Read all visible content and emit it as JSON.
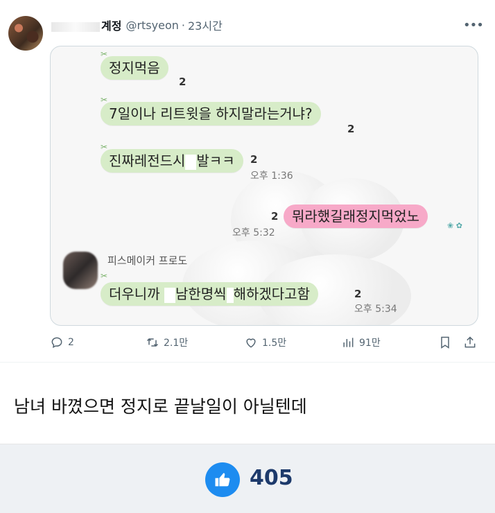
{
  "tweet": {
    "name_visible": "계정",
    "handle": "@rtsyeon",
    "dot": "·",
    "time": "23시간",
    "more_icon": "more-horizontal-icon"
  },
  "chat": {
    "messages": [
      {
        "text": "정지먹음",
        "count": "2"
      },
      {
        "text": "7일이나 리트윗을 하지말라는거냐?",
        "count": "2"
      },
      {
        "text_before": "진짜레전드시",
        "text_after": "발ㅋㅋ",
        "count": "2",
        "time": "오후 1:36"
      },
      {
        "text": "뭐라했길래정지먹었노",
        "count": "2",
        "time": "오후 5:32",
        "color": "#f7a9c8"
      },
      {
        "sender": "피스메이커 프로도",
        "text_before": "더우니까 ",
        "text_middle": "남한명씩",
        "text_after": "해하겠다고함",
        "count": "2",
        "time": "오후 5:34"
      }
    ],
    "bubble_color": "#d7ecc8"
  },
  "actions": {
    "reply": {
      "icon": "reply-icon",
      "count": "2"
    },
    "retweet": {
      "icon": "retweet-icon",
      "count": "2.1만"
    },
    "like": {
      "icon": "heart-icon",
      "count": "1.5만"
    },
    "views": {
      "icon": "analytics-icon",
      "count": "91만"
    },
    "bookmark": {
      "icon": "bookmark-icon"
    },
    "share": {
      "icon": "share-icon"
    }
  },
  "post": {
    "caption": "남녀 바꼈으면 정지로 끝날일이 아닐텐데",
    "likes": "405",
    "like_icon": "thumbs-up-icon",
    "accent": "#1d8cf0"
  }
}
